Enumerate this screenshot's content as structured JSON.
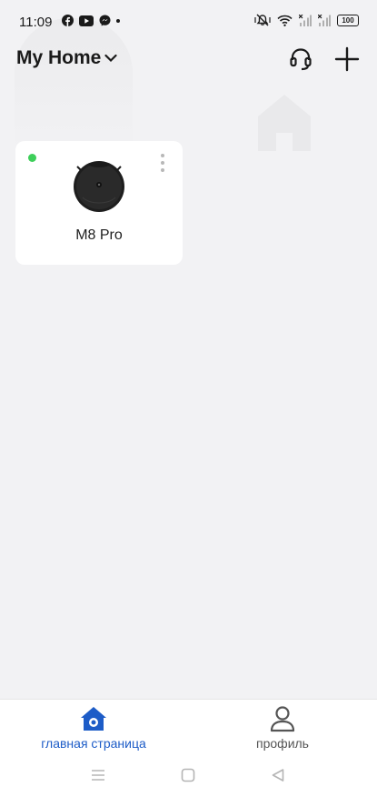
{
  "status_bar": {
    "time": "11:09",
    "left_icons": [
      "facebook-icon",
      "youtube-icon",
      "messenger-icon",
      "dot-icon"
    ],
    "right_icons": [
      "mute-vibrate-icon",
      "wifi-icon",
      "signal-icon",
      "signal-icon"
    ],
    "battery": "100"
  },
  "header": {
    "home_name": "My Home",
    "support_icon": "headset-icon",
    "add_icon": "plus-icon"
  },
  "devices": [
    {
      "name": "M8 Pro",
      "online": true,
      "status_color": "#3ecf5a"
    }
  ],
  "bottom_nav": {
    "home_label": "главная страница",
    "profile_label": "профиль",
    "active_color": "#1d5cc7"
  },
  "system_nav": [
    "menu-icon",
    "home-square-icon",
    "back-triangle-icon"
  ]
}
